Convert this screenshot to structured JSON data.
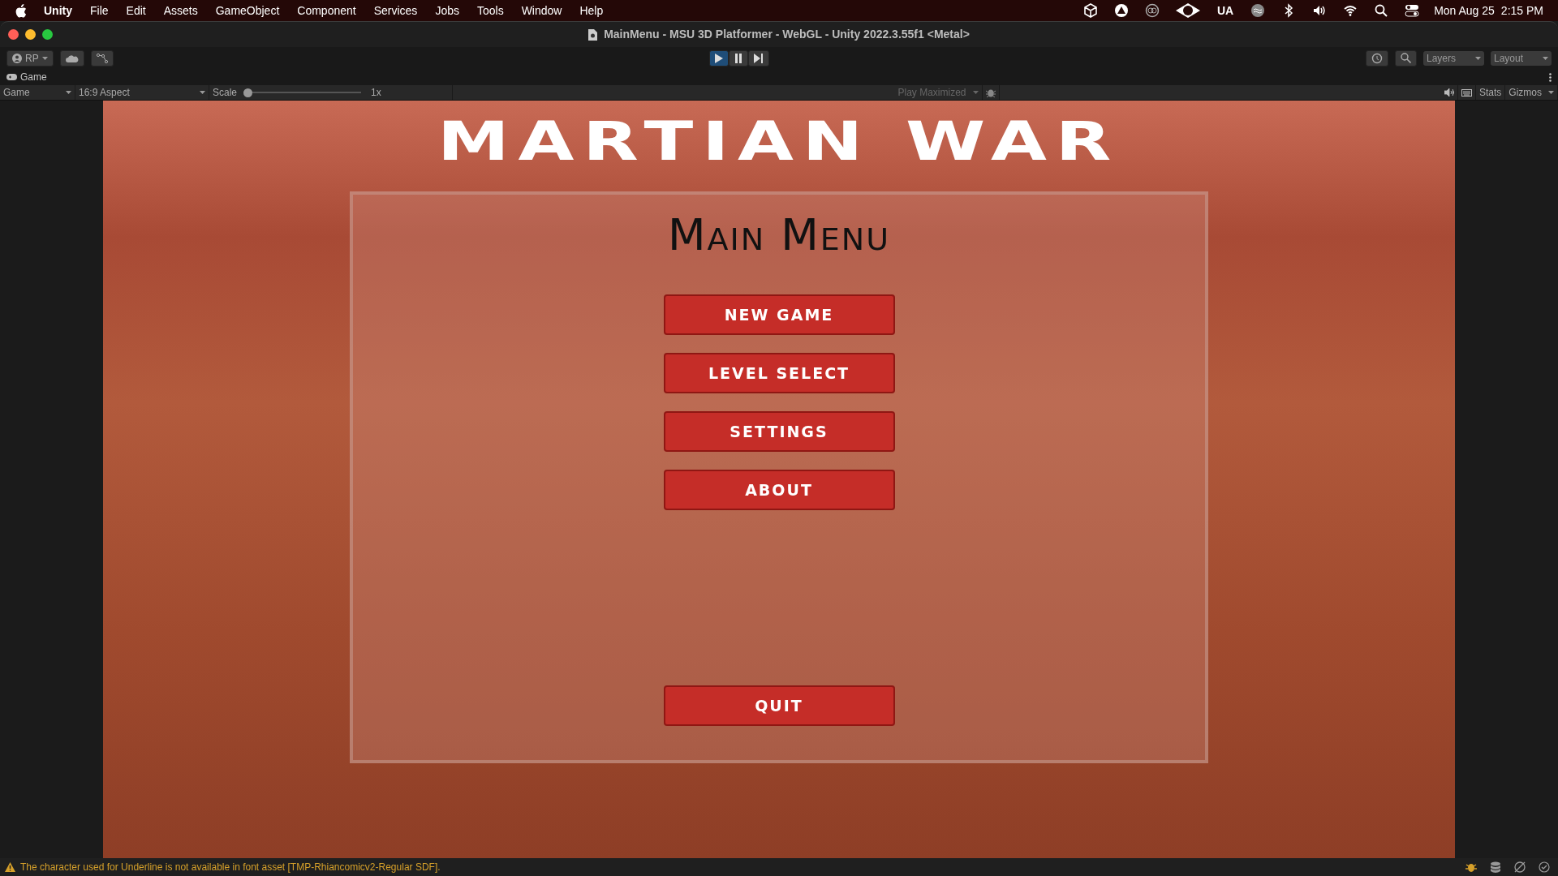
{
  "menu_bar": {
    "app": "Unity",
    "items": [
      "File",
      "Edit",
      "Assets",
      "GameObject",
      "Component",
      "Services",
      "Jobs",
      "Tools",
      "Window",
      "Help"
    ],
    "status_text": "UA",
    "date": "Mon Aug 25",
    "time": "2:15 PM"
  },
  "window": {
    "title": "MainMenu - MSU 3D Platformer - WebGL - Unity 2022.3.55f1 <Metal>"
  },
  "toolbar": {
    "account": "RP",
    "playing": true,
    "layers": "Layers",
    "layout": "Layout"
  },
  "game_tab": {
    "label": "Game"
  },
  "game_toolbar": {
    "display": "Game",
    "aspect": "16:9 Aspect",
    "scale_label": "Scale",
    "scale": {
      "level": 0
    },
    "scale_reading": "1x",
    "play_mode": "Play Maximized",
    "stats": "Stats",
    "gizmos": "Gizmos"
  },
  "game": {
    "title": "MARTIAN WAR",
    "heading": "Main Menu",
    "buttons": [
      {
        "label": "NEW GAME",
        "kind": "menu"
      },
      {
        "label": "LEVEL SELECT",
        "kind": "menu"
      },
      {
        "label": "SETTINGS",
        "kind": "menu"
      },
      {
        "label": "ABOUT",
        "kind": "menu"
      },
      {
        "label": "QUIT",
        "kind": "quit"
      }
    ]
  },
  "status_bar": {
    "message": "The character used for Underline is not available in font asset [TMP-Rhiancomicv2-Regular SDF]."
  }
}
